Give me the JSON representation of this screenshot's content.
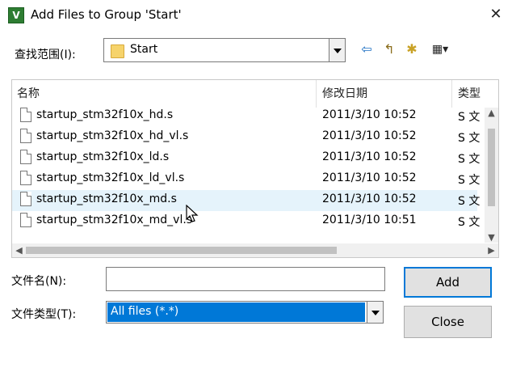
{
  "window": {
    "title": "Add Files to Group 'Start'",
    "close_glyph": "✕",
    "app_icon_letter": "V"
  },
  "look_in": {
    "label": "查找范围(I):",
    "value": "Start"
  },
  "toolbar": {
    "back_glyph": "⇦",
    "up_glyph": "↰",
    "new_folder_glyph": "✱",
    "view_glyph": "▦▾"
  },
  "list": {
    "columns": [
      "名称",
      "修改日期",
      "类型"
    ],
    "sort_glyph": "^",
    "rows": [
      {
        "name": "startup_stm32f10x_hd.s",
        "date": "2011/3/10 10:52",
        "type": "S 文"
      },
      {
        "name": "startup_stm32f10x_hd_vl.s",
        "date": "2011/3/10 10:52",
        "type": "S 文"
      },
      {
        "name": "startup_stm32f10x_ld.s",
        "date": "2011/3/10 10:52",
        "type": "S 文"
      },
      {
        "name": "startup_stm32f10x_ld_vl.s",
        "date": "2011/3/10 10:52",
        "type": "S 文"
      },
      {
        "name": "startup_stm32f10x_md.s",
        "date": "2011/3/10 10:52",
        "type": "S 文"
      },
      {
        "name": "startup_stm32f10x_md_vl.s",
        "date": "2011/3/10 10:51",
        "type": "S 文"
      }
    ]
  },
  "filename": {
    "label": "文件名(N):",
    "value": ""
  },
  "filetype": {
    "label": "文件类型(T):",
    "value": "All files (*.*)"
  },
  "buttons": {
    "add": "Add",
    "close": "Close"
  },
  "colors": {
    "selection": "#0078d7",
    "hover_row": "#e5f3fb"
  }
}
